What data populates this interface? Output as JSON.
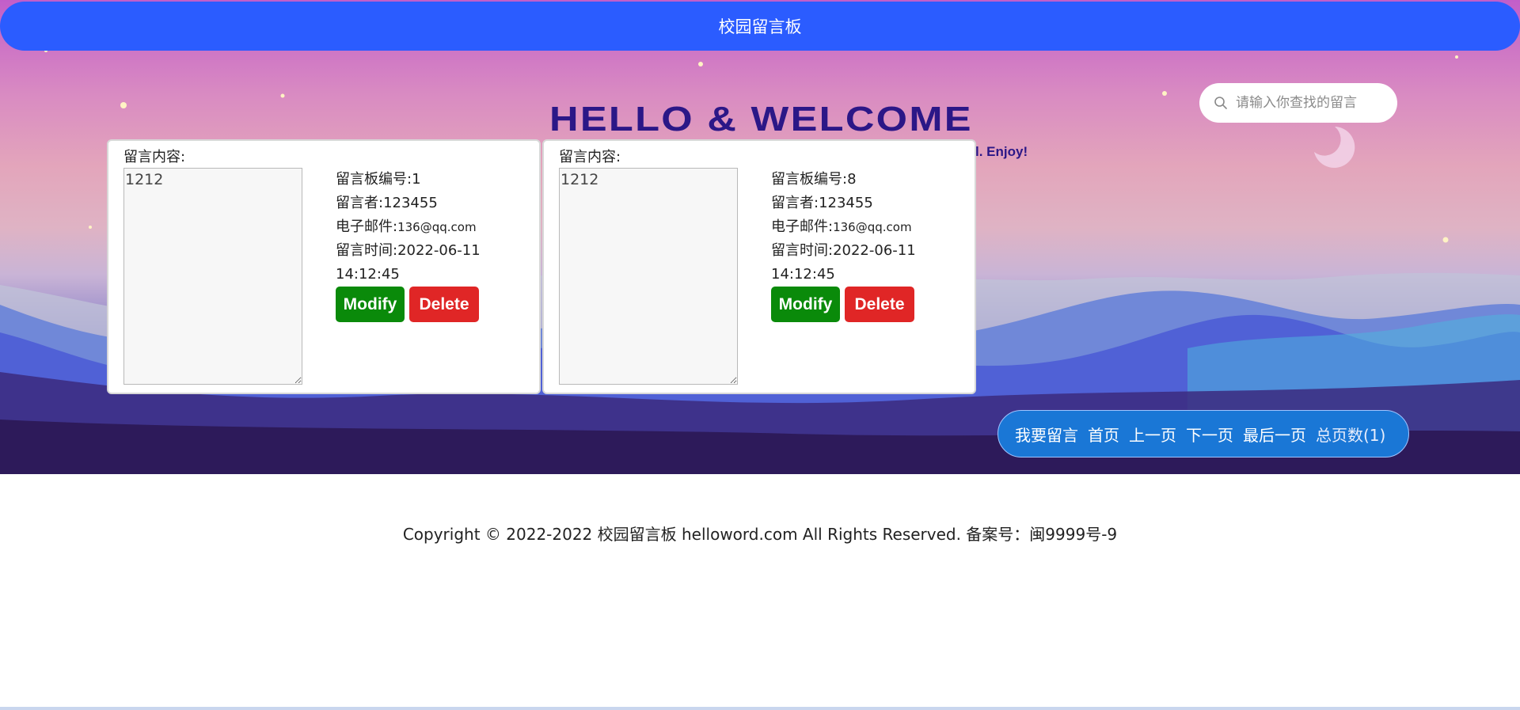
{
  "header": {
    "title": "校园留言板"
  },
  "hero": {
    "welcome_text": "HELLO & WELCOME",
    "subtitle_fragment": "l. Enjoy!"
  },
  "search": {
    "placeholder": "请输入你查找的留言"
  },
  "cards": [
    {
      "content_label": "留言内容:",
      "content": "1212",
      "board_id": "留言板编号:1",
      "author": "留言者:123455",
      "email_label": "电子邮件:",
      "email": "136@qq.com",
      "time_label": "留言时间:2022-06-11",
      "time_rest": "14:12:45",
      "modify_label": "Modify",
      "delete_label": "Delete"
    },
    {
      "content_label": "留言内容:",
      "content": "1212",
      "board_id": "留言板编号:8",
      "author": "留言者:123455",
      "email_label": "电子邮件:",
      "email": "136@qq.com",
      "time_label": "留言时间:2022-06-11",
      "time_rest": "14:12:45",
      "modify_label": "Modify",
      "delete_label": "Delete"
    }
  ],
  "pager": {
    "post": "我要留言",
    "first": "首页",
    "prev": "上一页",
    "next": "下一页",
    "last": "最后一页",
    "total": "总页数(1)"
  },
  "footer": {
    "copyright": "Copyright © 2022-2022 校园留言板 helloword.com All Rights Reserved. 备案号：闽9999号-9"
  },
  "colors": {
    "topbar": "#2b5cff",
    "modify": "#0a8a0a",
    "delete": "#e02626",
    "pager": "#1a77d6"
  }
}
